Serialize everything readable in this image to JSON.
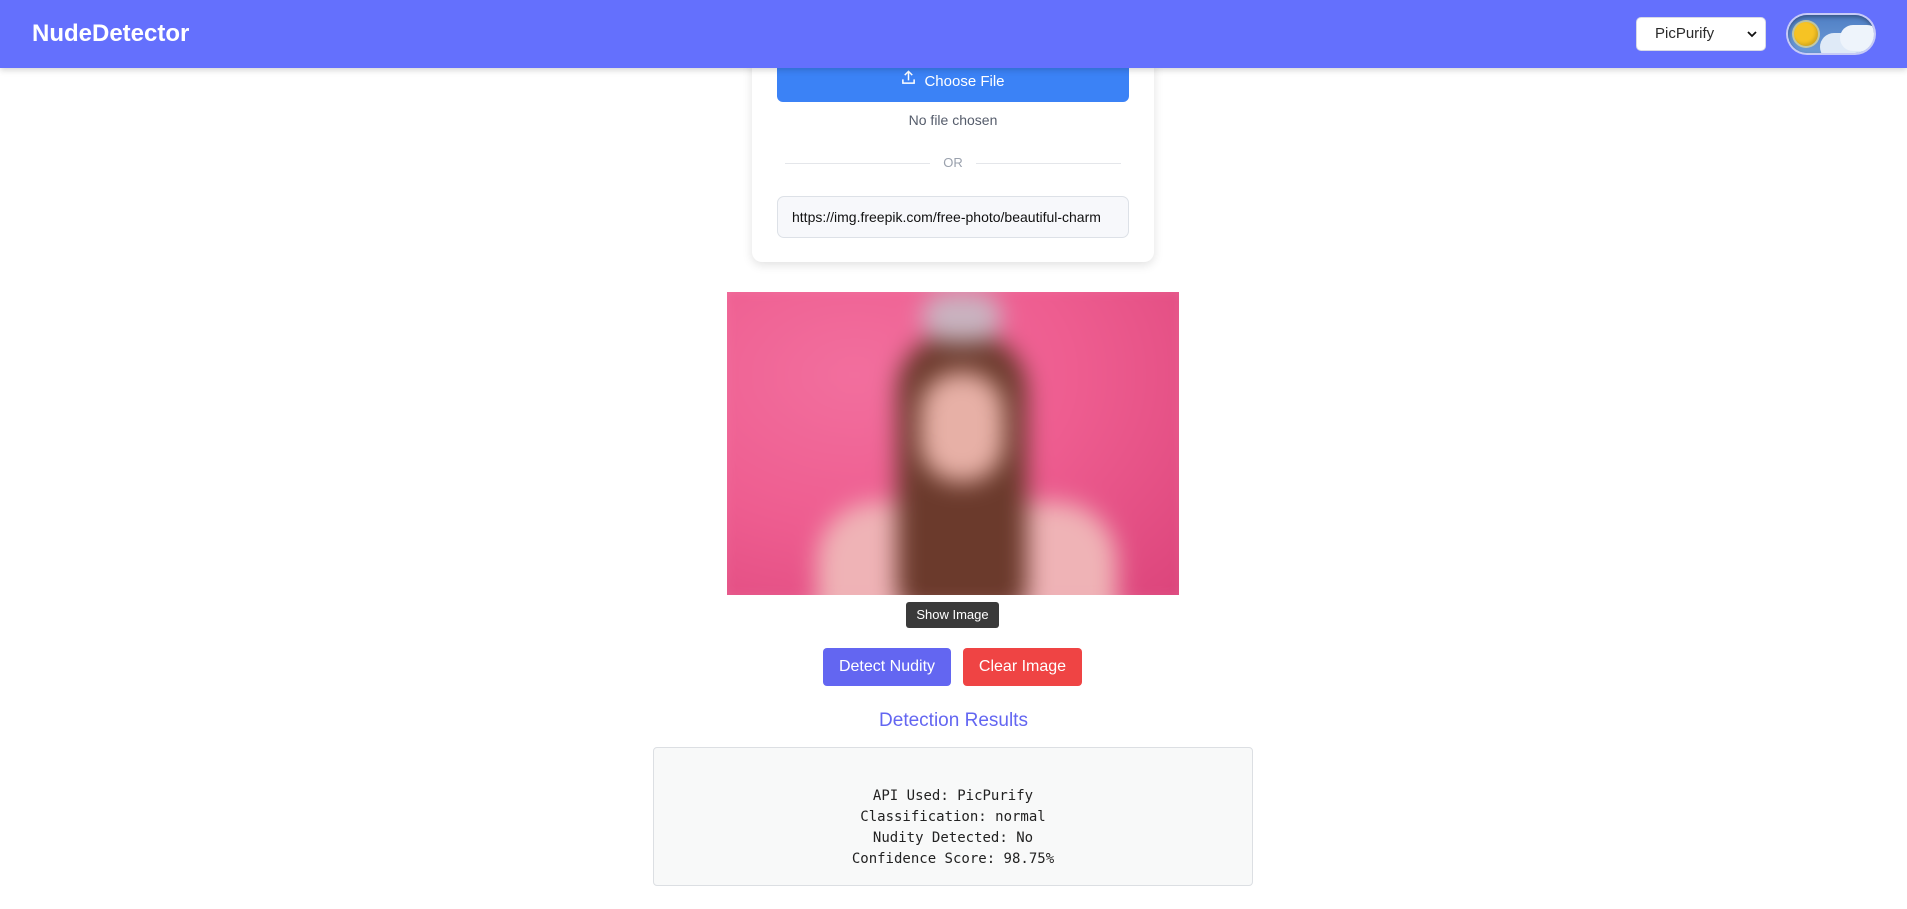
{
  "header": {
    "brand": "NudeDetector",
    "api_select": {
      "selected": "PicPurify"
    },
    "theme_toggle": {
      "icon": "sun-cloud-toggle-icon",
      "mode": "light"
    }
  },
  "upload": {
    "choose_file_label": "Choose File",
    "no_file_text": "No file chosen",
    "divider_text": "OR",
    "url_value": "https://img.freepik.com/free-photo/beautiful-charm"
  },
  "preview": {
    "show_image_label": "Show Image",
    "blurred": true
  },
  "actions": {
    "detect_label": "Detect Nudity",
    "clear_label": "Clear Image"
  },
  "results": {
    "title": "Detection Results",
    "lines": [
      "API Used: PicPurify",
      "Classification: normal",
      "Nudity Detected: No",
      "Confidence Score: 98.75%"
    ]
  },
  "colors": {
    "navbar": "#6470fd",
    "choose_file": "#3b82f6",
    "detect": "#6366f1",
    "clear": "#ef4444",
    "results_title": "#6366f1"
  }
}
